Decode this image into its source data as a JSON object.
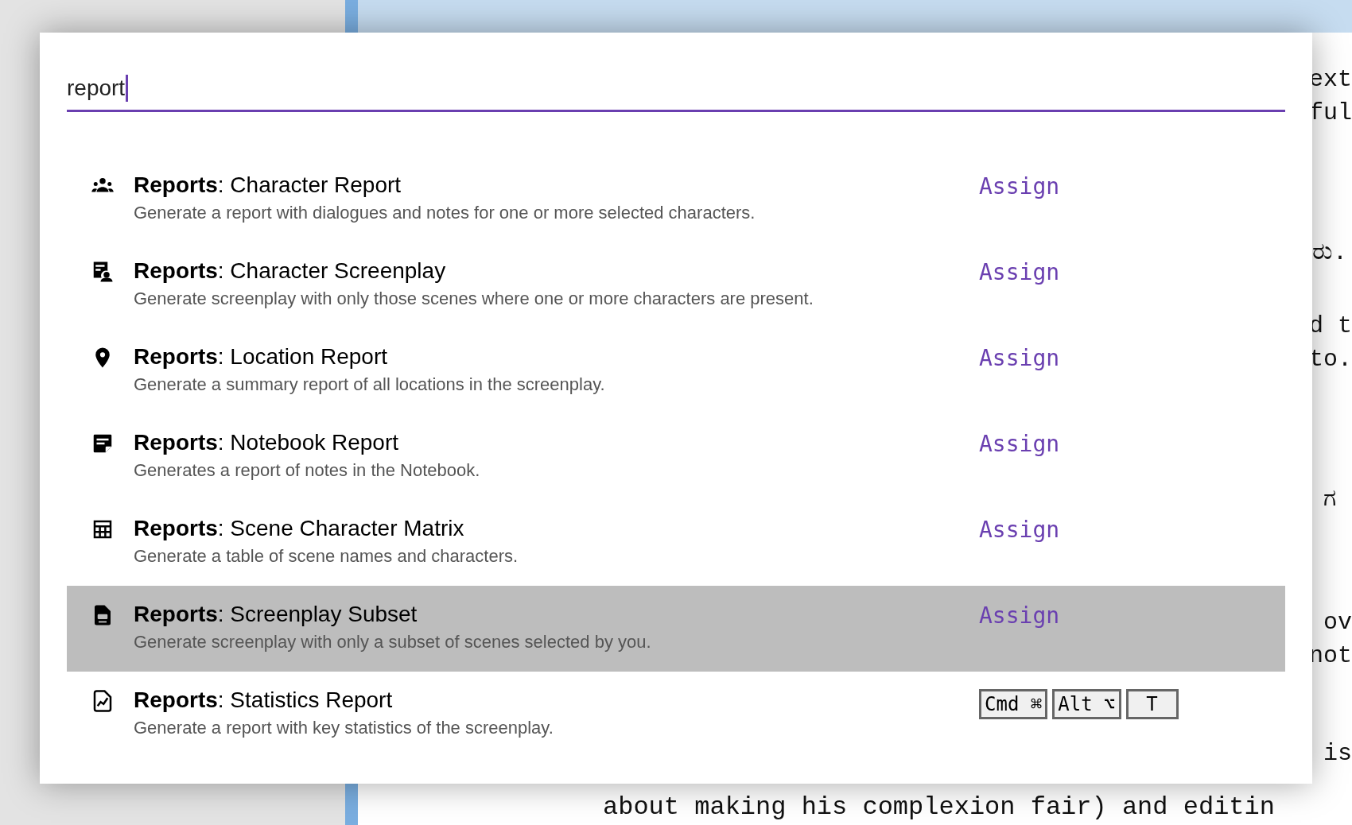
{
  "search": {
    "value": "report"
  },
  "commands": [
    {
      "title": "**Reports**: Character Report",
      "description": "Generate a report with dialogues and notes for one or more selected characters.",
      "selected": false,
      "shortcut": {
        "kind": "assign",
        "label": "Assign"
      }
    },
    {
      "title": "**Reports**: Character Screenplay",
      "description": "Generate screenplay with only those scenes where one or more characters are present.",
      "selected": false,
      "shortcut": {
        "kind": "assign",
        "label": "Assign"
      }
    },
    {
      "title": "**Reports**: Location Report",
      "description": "Generate a summary report of all locations in the screenplay.",
      "selected": false,
      "shortcut": {
        "kind": "assign",
        "label": "Assign"
      }
    },
    {
      "title": "**Reports**: Notebook Report",
      "description": "Generates a report of notes in the Notebook.",
      "selected": false,
      "shortcut": {
        "kind": "assign",
        "label": "Assign"
      }
    },
    {
      "title": "**Reports**: Scene Character Matrix",
      "description": "Generate a table of scene names and characters.",
      "selected": false,
      "shortcut": {
        "kind": "assign",
        "label": "Assign"
      }
    },
    {
      "title": "**Reports**: Screenplay Subset",
      "description": "Generate screenplay with only a subset of scenes selected by you.",
      "selected": true,
      "shortcut": {
        "kind": "assign",
        "label": "Assign"
      }
    },
    {
      "title": "**Reports**: Statistics Report",
      "description": "Generate a report with key statistics of the screenplay.",
      "selected": false,
      "shortcut": {
        "kind": "keys",
        "keys": [
          "Cmd ⌘",
          "Alt ⌥",
          "T"
        ]
      }
    }
  ],
  "background_document": {
    "edge_lines": [
      "ext",
      "ful",
      "ರು.",
      "d t",
      "to.",
      "ಗ",
      "ov",
      "not",
      "is"
    ],
    "bottom_lines": [
      "about making his complexion fair) and editin"
    ]
  }
}
